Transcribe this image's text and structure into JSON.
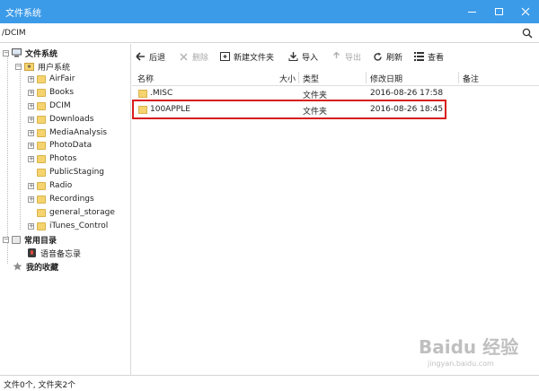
{
  "window": {
    "title": "文件系统"
  },
  "address": {
    "path": "/DCIM"
  },
  "tree": {
    "root_label": "文件系统",
    "user_label": "用户系统",
    "user_items": [
      "AirFair",
      "Books",
      "DCIM",
      "Downloads",
      "MediaAnalysis",
      "PhotoData",
      "Photos",
      "PublicStaging",
      "Radio",
      "Recordings",
      "general_storage",
      "iTunes_Control"
    ],
    "common_label": "常用目录",
    "common_items": [
      "语音备忘录"
    ],
    "favorites_label": "我的收藏"
  },
  "toolbar": {
    "back": "后退",
    "delete": "删除",
    "new_folder": "新建文件夹",
    "import": "导入",
    "export": "导出",
    "refresh": "刷新",
    "view": "查看"
  },
  "columns": {
    "name": "名称",
    "size": "大小",
    "type": "类型",
    "date": "修改日期",
    "note": "备注"
  },
  "files": [
    {
      "name": ".MISC",
      "size": "",
      "type": "文件夹",
      "date": "2016-08-26 17:58",
      "note": ""
    },
    {
      "name": "100APPLE",
      "size": "",
      "type": "文件夹",
      "date": "2016-08-26 18:45",
      "note": ""
    }
  ],
  "status": {
    "text": "文件0个, 文件夹2个"
  },
  "watermark": {
    "text": "Baidu 经验",
    "sub": "jingyan.baidu.com"
  },
  "colors": {
    "titlebar": "#3c9be8",
    "highlight": "#d81e1e",
    "folder": "#f5d36e"
  }
}
